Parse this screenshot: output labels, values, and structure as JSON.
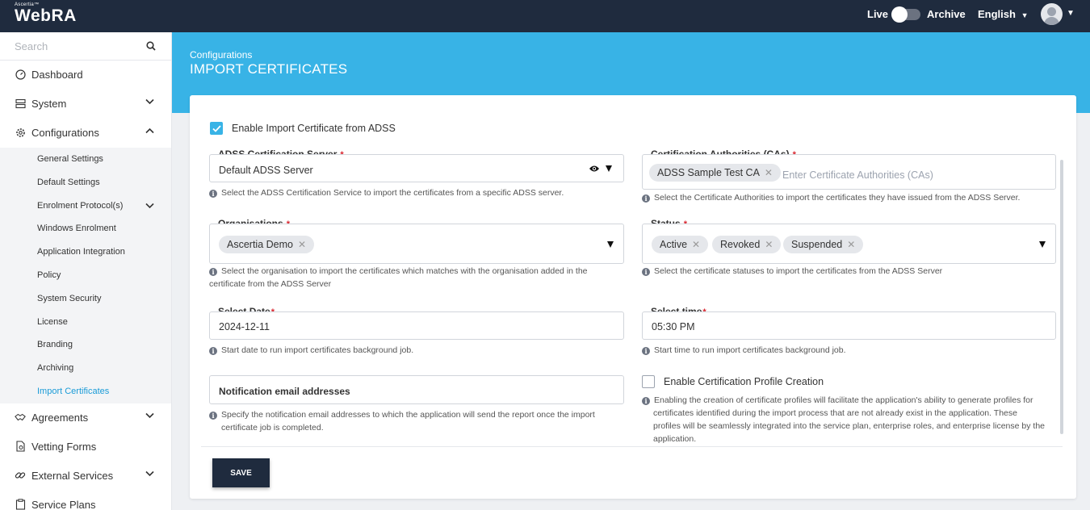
{
  "topbar": {
    "brand_small": "Ascertia™",
    "brand": "WebRA",
    "live_label": "Live",
    "archive_label": "Archive",
    "language": "English"
  },
  "sidebar": {
    "search_placeholder": "Search",
    "items": [
      {
        "label": "Dashboard"
      },
      {
        "label": "System"
      },
      {
        "label": "Configurations"
      },
      {
        "label": "Agreements"
      },
      {
        "label": "Vetting Forms"
      },
      {
        "label": "External Services"
      },
      {
        "label": "Service Plans"
      }
    ],
    "submenu": [
      {
        "label": "General Settings"
      },
      {
        "label": "Default Settings"
      },
      {
        "label": "Enrolment Protocol(s)"
      },
      {
        "label": "Windows Enrolment"
      },
      {
        "label": "Application Integration"
      },
      {
        "label": "Policy"
      },
      {
        "label": "System Security"
      },
      {
        "label": "License"
      },
      {
        "label": "Branding"
      },
      {
        "label": "Archiving"
      },
      {
        "label": "Import Certificates"
      }
    ]
  },
  "header": {
    "breadcrumb": "Configurations",
    "title": "IMPORT CERTIFICATES"
  },
  "form": {
    "enable_import_label": "Enable Import Certificate from ADSS",
    "adss_server": {
      "label": "ADSS Certification Server",
      "required": "*",
      "value": "Default ADSS Server",
      "hint": "Select the ADSS Certification Service to import the certificates from a specific ADSS server."
    },
    "cas": {
      "label": "Certification Authorities (CAs)",
      "required": "*",
      "chips": [
        "ADSS Sample Test CA"
      ],
      "placeholder": "Enter Certificate Authorities (CAs)",
      "hint": "Select the Certificate Authorities to import the certificates they have issued from the ADSS Server."
    },
    "organisations": {
      "label": "Organisations",
      "required": "*",
      "chips": [
        "Ascertia Demo"
      ],
      "hint_line1": "Select the organisation to import the certificates which matches with the organisation added in the",
      "hint_line2": "certificate from the ADSS Server"
    },
    "status": {
      "label": "Status",
      "required": "*",
      "chips": [
        "Active",
        "Revoked",
        "Suspended"
      ],
      "hint": "Select the certificate statuses to import the certificates from the ADSS Server"
    },
    "date": {
      "label": "Select Date",
      "required": "*",
      "value": "2024-12-11",
      "hint": "Start date to run import certificates background job."
    },
    "time": {
      "label": "Select time",
      "required": "*",
      "value": "05:30 PM",
      "hint": "Start time to run import certificates background job."
    },
    "notification": {
      "placeholder": "Notification email addresses",
      "hint_line1": "Specify the notification email addresses to which the application will send the report once the import",
      "hint_line2": "certificate job is completed."
    },
    "profile_creation": {
      "label": "Enable Certification Profile Creation",
      "hint_line1": "Enabling the creation of certificate profiles will facilitate the application's ability to generate profiles for",
      "hint_line2": "certificates identified during the import process that are not already exist in the application. These",
      "hint_line3": "profiles will be seamlessly integrated into the service plan, enterprise roles, and enterprise license by the",
      "hint_line4": "application."
    },
    "save_label": "SAVE"
  },
  "colors": {
    "topbar": "#1f2b3e",
    "banner": "#38b3e6",
    "active_link": "#1a9bd7",
    "required": "#d9262f"
  }
}
